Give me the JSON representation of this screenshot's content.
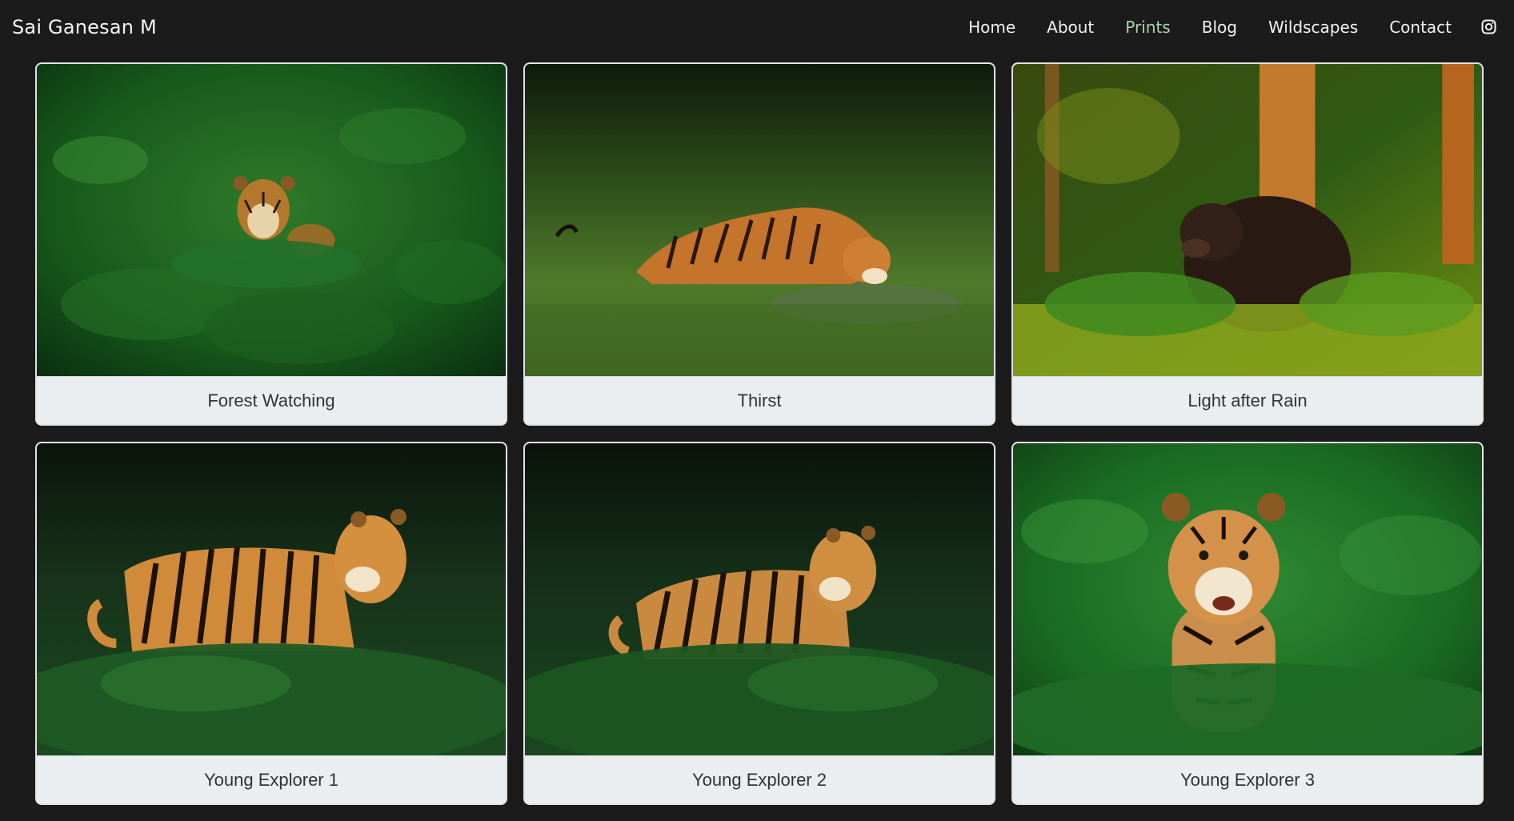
{
  "brand": "Sai Ganesan M",
  "nav": {
    "home": "Home",
    "about": "About",
    "prints": "Prints",
    "blog": "Blog",
    "wildscapes": "Wildscapes",
    "contact": "Contact"
  },
  "nav_active": "Prints",
  "icons": {
    "social": "instagram-icon"
  },
  "colors": {
    "background": "#1b1b1b",
    "active_link": "#a7d7b0",
    "caption_bg": "#eaeef0",
    "caption_text": "#303437"
  },
  "gallery": [
    {
      "caption": "Forest Watching"
    },
    {
      "caption": "Thirst"
    },
    {
      "caption": "Light after Rain"
    },
    {
      "caption": "Young Explorer 1"
    },
    {
      "caption": "Young Explorer 2"
    },
    {
      "caption": "Young Explorer 3"
    }
  ]
}
